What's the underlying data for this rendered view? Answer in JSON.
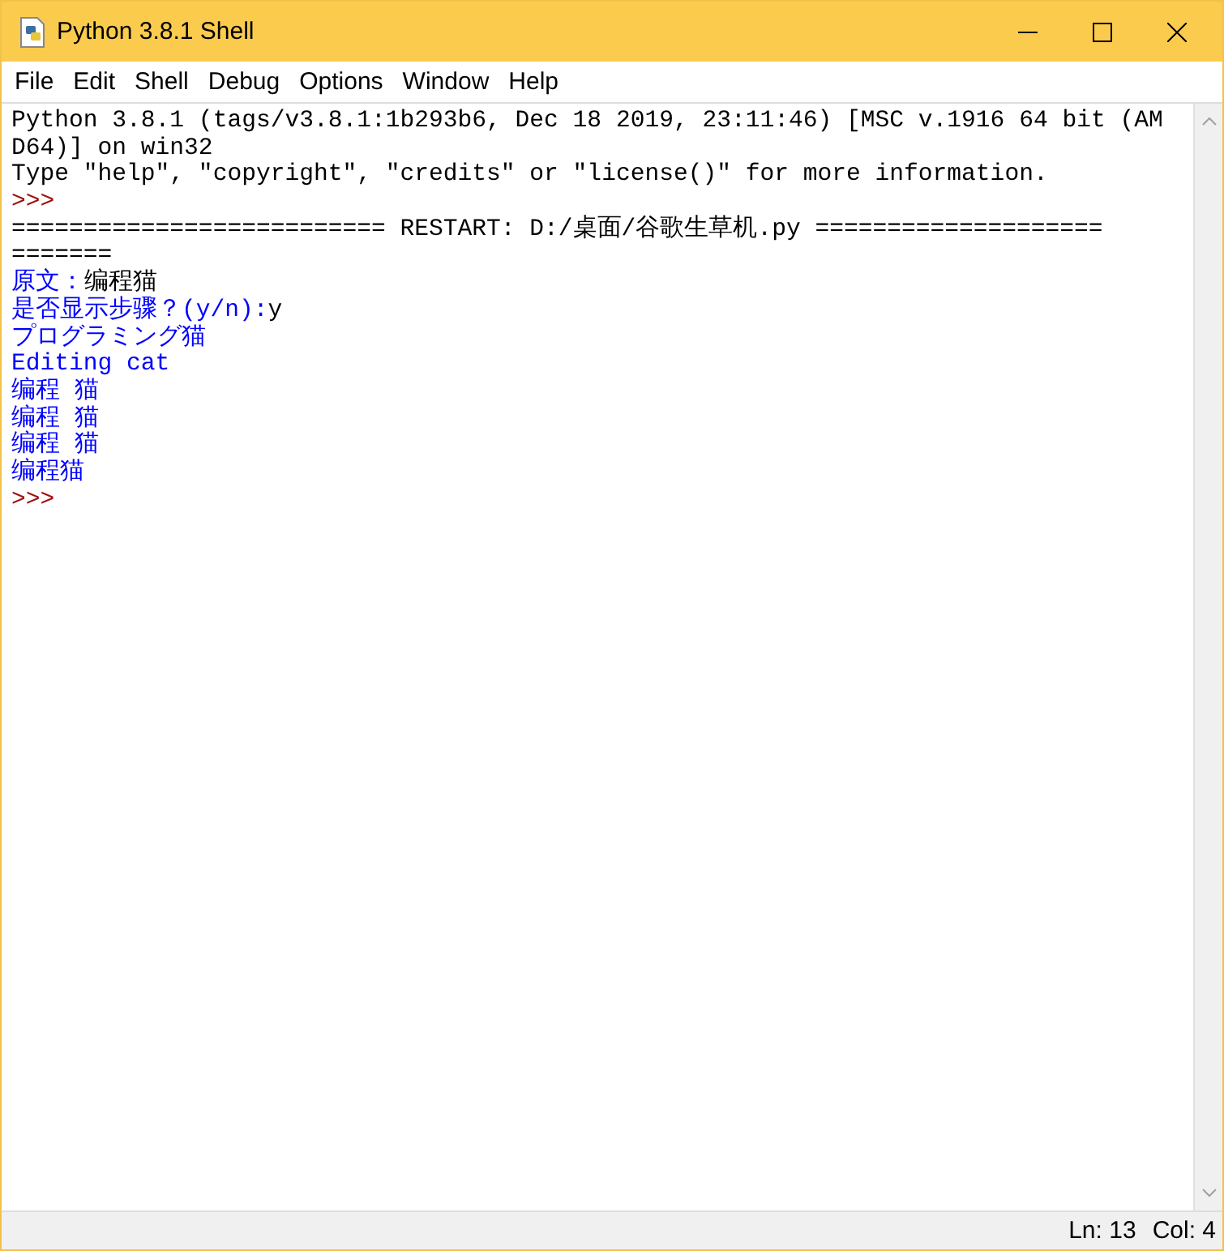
{
  "window": {
    "title": "Python 3.8.1 Shell"
  },
  "menu": [
    "File",
    "Edit",
    "Shell",
    "Debug",
    "Options",
    "Window",
    "Help"
  ],
  "lines": [
    [
      {
        "kind": "output",
        "text": "Python 3.8.1 (tags/v3.8.1:1b293b6, Dec 18 2019, 23:11:46) [MSC v.1916 64 bit (AM"
      }
    ],
    [
      {
        "kind": "output",
        "text": "D64)] on win32"
      }
    ],
    [
      {
        "kind": "output",
        "text": "Type \"help\", \"copyright\", \"credits\" or \"license()\" for more information."
      }
    ],
    [
      {
        "kind": "prompt",
        "text": ">>>"
      }
    ],
    [
      {
        "kind": "output",
        "text": "========================== RESTART: D:/桌面/谷歌生草机.py ===================="
      }
    ],
    [
      {
        "kind": "output",
        "text": "======="
      }
    ],
    [
      {
        "kind": "stdout",
        "text": "原文："
      },
      {
        "kind": "input",
        "text": "编程猫"
      }
    ],
    [
      {
        "kind": "stdout",
        "text": "是否显示步骤？(y/n):"
      },
      {
        "kind": "input",
        "text": "y"
      }
    ],
    [
      {
        "kind": "stdout",
        "text": "プログラミング猫"
      }
    ],
    [
      {
        "kind": "stdout",
        "text": "Editing cat"
      }
    ],
    [
      {
        "kind": "stdout",
        "text": "编程 猫"
      }
    ],
    [
      {
        "kind": "stdout",
        "text": "编程 猫"
      }
    ],
    [
      {
        "kind": "stdout",
        "text": "编程 猫"
      }
    ],
    [
      {
        "kind": "stdout",
        "text": "编程猫"
      }
    ],
    [
      {
        "kind": "prompt",
        "text": ">>>"
      }
    ]
  ],
  "status_bar": {
    "line": "Ln: 13",
    "column": "Col: 4"
  }
}
